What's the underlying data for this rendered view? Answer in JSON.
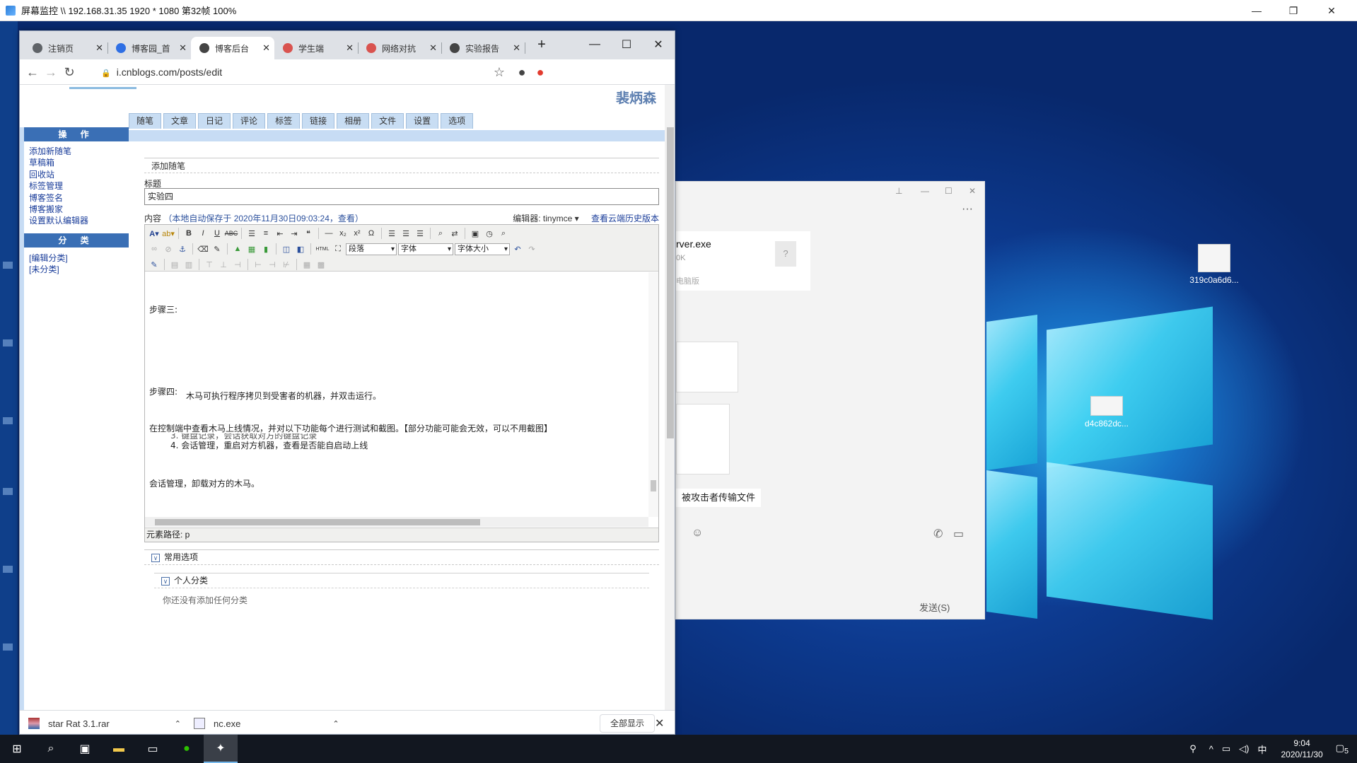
{
  "monitor": {
    "title": "屏幕监控 \\\\ 192.168.31.35 1920 * 1080 第32帧 100%",
    "minimize": "—",
    "maximize": "❐",
    "close": "✕"
  },
  "browser": {
    "tabs": [
      {
        "label": "注销页",
        "icon": "globe-icon",
        "color": "#5f6368"
      },
      {
        "label": "博客园_首",
        "icon": "paw-icon",
        "color": "#2f6fe4"
      },
      {
        "label": "博客后台",
        "icon": "cnblogs-icon",
        "color": "#444444"
      },
      {
        "label": "学生端",
        "icon": "shield-icon",
        "color": "#d9534f"
      },
      {
        "label": "网络对抗",
        "icon": "shield-icon",
        "color": "#d9534f"
      },
      {
        "label": "实验报告",
        "icon": "cnblogs-icon",
        "color": "#444444"
      }
    ],
    "tab_close": "✕",
    "new_tab": "+",
    "win_min": "—",
    "win_max": "☐",
    "win_close": "✕",
    "url": "i.cnblogs.com/posts/edit",
    "back": "←",
    "forward": "→",
    "reload": "↻",
    "star": "☆",
    "profile": "●",
    "ext": "●"
  },
  "page": {
    "username": "裴炳森",
    "nav_tabs": [
      "随笔",
      "文章",
      "日记",
      "评论",
      "标签",
      "链接",
      "相册",
      "文件",
      "设置",
      "选项"
    ],
    "sidebar": {
      "head_ops": "操 作",
      "ops_links": [
        "添加新随笔",
        "草稿箱",
        "回收站",
        "标签管理",
        "博客签名",
        "博客搬家",
        "设置默认编辑器"
      ],
      "head_cats": "分 类",
      "cat_links": [
        "[编辑分类]",
        "[未分类]"
      ]
    },
    "section_title": "添加随笔",
    "title_label": "标题",
    "title_value": "实验四",
    "content_label": "内容",
    "autosave": "（本地自动保存于 2020年11月30日09:03:24，",
    "autosave_view": "查看）",
    "editor_label": "编辑器: tinymce ▾",
    "history_link": "查看云端历史版本",
    "toolbar": {
      "block_select": "段落",
      "font_select": "字体",
      "size_select": "字体大小"
    },
    "editor_lines": [
      "步骤三:",
      "步骤四:",
      "木马可执行程序拷贝到受害者的机器，并双击运行。",
      "在控制端中查看木马上线情况，并对以下功能每个进行测试和截图。【部分功能可能会无效，可以不用截图】",
      "3. 键盘记录，会话获取对方的键盘记录",
      "4. 会话管理，重启对方机器，查看是否能自启动上线",
      "会话管理，卸载对方的木马。"
    ],
    "element_path": "元素路径: p",
    "opt_common": "常用选项",
    "opt_personal": "个人分类",
    "no_category": "你还没有添加任何分类"
  },
  "downloads": {
    "items": [
      {
        "name": "star Rat 3.1.rar",
        "icon": "archive-icon"
      },
      {
        "name": "nc.exe",
        "icon": "exe-icon"
      }
    ],
    "show_all": "全部显示",
    "close": "✕"
  },
  "chat": {
    "file_name": "rver.exe",
    "file_size": "0K",
    "file_tag": "电脑版",
    "message": "被攻击者传输文件",
    "send": "发送(S)",
    "more": "···"
  },
  "desktop_icons": [
    {
      "label": "319c0a6d6..."
    },
    {
      "label": "d4c862dc..."
    }
  ],
  "taskbar": {
    "time": "9:04",
    "date": "2020/11/30",
    "ime": "中",
    "notif": "5"
  }
}
